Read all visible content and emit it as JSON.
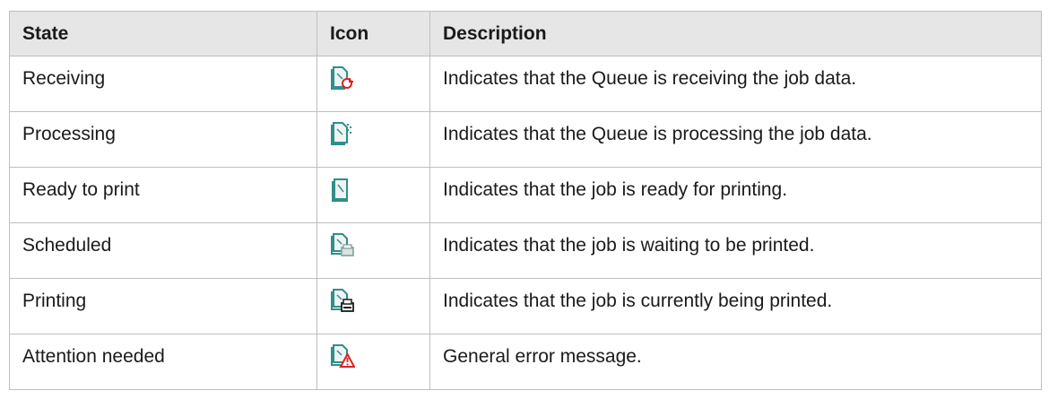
{
  "table": {
    "headers": {
      "state": "State",
      "icon": "Icon",
      "description": "Description"
    },
    "rows": [
      {
        "state": "Receiving",
        "icon": "document-receiving-icon",
        "description": "Indicates that the Queue is receiving the job data."
      },
      {
        "state": "Processing",
        "icon": "document-processing-icon",
        "description": "Indicates that the Queue is processing the job data."
      },
      {
        "state": "Ready to print",
        "icon": "document-ready-icon",
        "description": "Indicates that the job is ready for printing."
      },
      {
        "state": "Scheduled",
        "icon": "document-scheduled-printer-icon",
        "description": "Indicates that the job is waiting to be printed."
      },
      {
        "state": "Printing",
        "icon": "document-printing-printer-icon",
        "description": "Indicates that the job is currently being printed."
      },
      {
        "state": "Attention needed",
        "icon": "document-warning-icon",
        "description": "General error message."
      }
    ]
  },
  "colors": {
    "header_bg": "#e6e6e6",
    "border": "#bfbfbf",
    "icon_teal": "#2f8f8a",
    "alert_red": "#e02020"
  }
}
